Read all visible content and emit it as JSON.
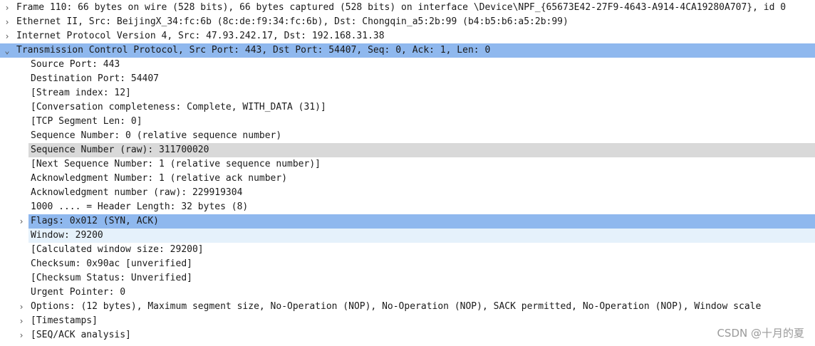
{
  "rows": [
    {
      "text": "Frame 110: 66 bytes on wire (528 bits), 66 bytes captured (528 bits) on interface \\Device\\NPF_{65673E42-27F9-4643-A914-4CA19280A707}, id 0",
      "expander": "›"
    },
    {
      "text": "Ethernet II, Src: BeijingX_34:fc:6b (8c:de:f9:34:fc:6b), Dst: Chongqin_a5:2b:99 (b4:b5:b6:a5:2b:99)",
      "expander": "›"
    },
    {
      "text": "Internet Protocol Version 4, Src: 47.93.242.17, Dst: 192.168.31.38",
      "expander": "›"
    },
    {
      "text": "Transmission Control Protocol, Src Port: 443, Dst Port: 54407, Seq: 0, Ack: 1, Len: 0",
      "expander": "⌄"
    }
  ],
  "tcp_fields": [
    {
      "text": "Source Port: 443"
    },
    {
      "text": "Destination Port: 54407"
    },
    {
      "text": "[Stream index: 12]"
    },
    {
      "text": "[Conversation completeness: Complete, WITH_DATA (31)]"
    },
    {
      "text": "[TCP Segment Len: 0]"
    },
    {
      "text": "Sequence Number: 0    (relative sequence number)"
    },
    {
      "text": "Sequence Number (raw): 311700020"
    },
    {
      "text": "[Next Sequence Number: 1    (relative sequence number)]"
    },
    {
      "text": "Acknowledgment Number: 1    (relative ack number)"
    },
    {
      "text": "Acknowledgment number (raw): 229919304"
    },
    {
      "text": "1000 .... = Header Length: 32 bytes (8)"
    },
    {
      "text": "Flags: 0x012 (SYN, ACK)",
      "expander": "›"
    },
    {
      "text": "Window: 29200"
    },
    {
      "text": "[Calculated window size: 29200]"
    },
    {
      "text": "Checksum: 0x90ac [unverified]"
    },
    {
      "text": "[Checksum Status: Unverified]"
    },
    {
      "text": "Urgent Pointer: 0"
    },
    {
      "text": "Options: (12 bytes), Maximum segment size, No-Operation (NOP), No-Operation (NOP), SACK permitted, No-Operation (NOP), Window scale",
      "expander": "›"
    },
    {
      "text": "[Timestamps]",
      "expander": "›"
    },
    {
      "text": "[SEQ/ACK analysis]",
      "expander": "›"
    }
  ],
  "watermark": "CSDN @十月的夏",
  "colors": {
    "selection": "#8fb8ee",
    "hover": "#d9d9d9",
    "light_selection": "#e5f1fb"
  }
}
